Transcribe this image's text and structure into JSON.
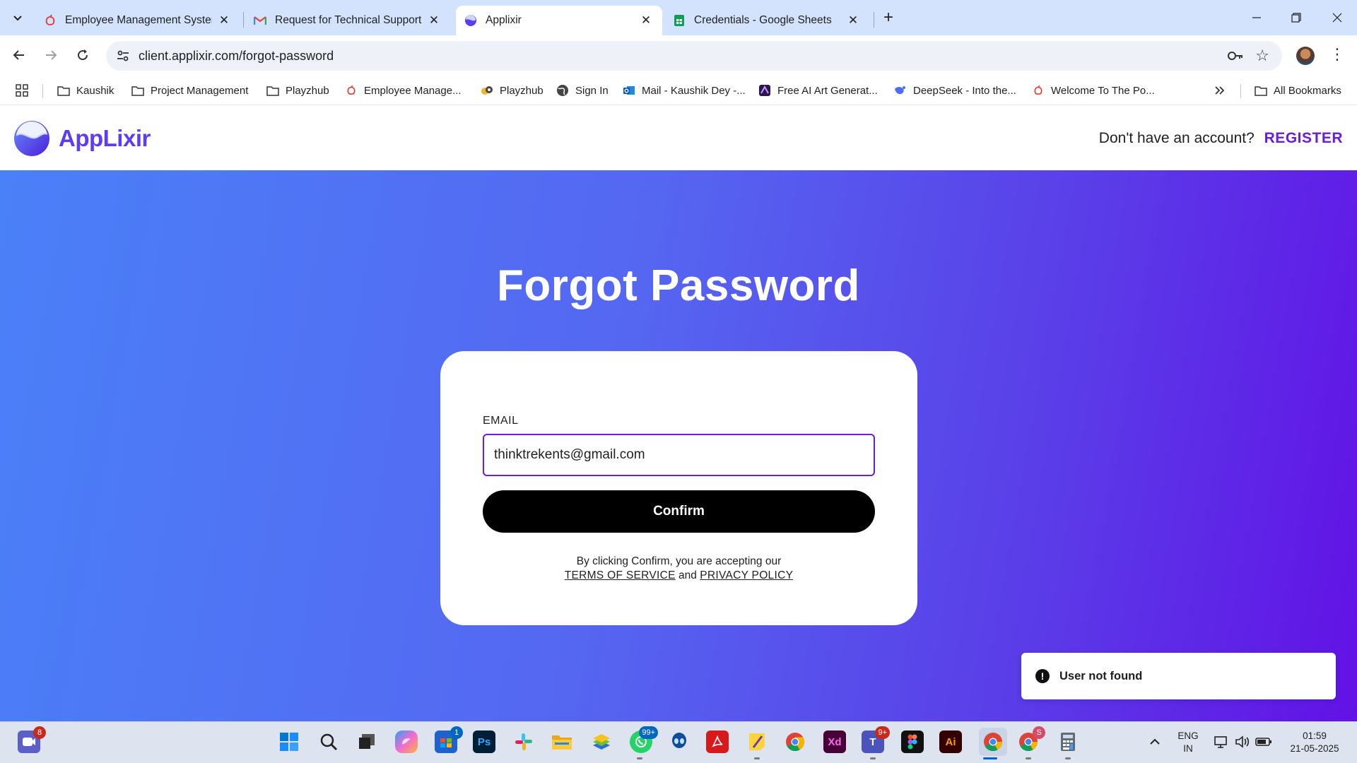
{
  "browser": {
    "tabs": [
      {
        "title": "Employee Management System",
        "icon": "acorn-red-icon"
      },
      {
        "title": "Request for Technical Support a",
        "icon": "gmail-icon"
      },
      {
        "title": "Applixir",
        "icon": "applixir-icon",
        "active": true
      },
      {
        "title": "Credentials - Google Sheets",
        "icon": "sheets-icon"
      }
    ],
    "url": "client.applixir.com/forgot-password",
    "bookmarks": [
      {
        "label": "Kaushik",
        "icon": "folder-icon"
      },
      {
        "label": "Project Management",
        "icon": "folder-icon"
      },
      {
        "label": "Playzhub",
        "icon": "folder-icon"
      },
      {
        "label": "Employee Manage...",
        "icon": "acorn-red-icon"
      },
      {
        "label": "Playzhub",
        "icon": "playzhub-icon"
      },
      {
        "label": "Sign In",
        "icon": "globe-icon"
      },
      {
        "label": "Mail - Kaushik Dey -...",
        "icon": "outlook-icon"
      },
      {
        "label": "Free AI Art Generat...",
        "icon": "ai-art-icon"
      },
      {
        "label": "DeepSeek - Into the...",
        "icon": "deepseek-icon"
      },
      {
        "label": "Welcome To The Po...",
        "icon": "acorn-red-icon"
      }
    ],
    "all_bookmarks": "All Bookmarks"
  },
  "site": {
    "logo_text": "AppLixir",
    "account_prompt": "Don't have an account?",
    "register_label": "REGISTER"
  },
  "form": {
    "title": "Forgot Password",
    "email_label": "EMAIL",
    "email_value": "thinktrekents@gmail.com",
    "confirm_label": "Confirm",
    "legal_prefix": "By clicking Confirm, you are accepting our",
    "terms_label": "TERMS OF SERVICE",
    "and_text": "and",
    "privacy_label": "PRIVACY POLICY"
  },
  "toast": {
    "message": "User not found"
  },
  "taskbar": {
    "badges": {
      "teams_chat": "8",
      "store": "1",
      "whatsapp": "99+",
      "teams": "9+",
      "chrome_profile": "S"
    },
    "language": "ENG",
    "region": "IN",
    "time": "01:59",
    "date": "21-05-2025"
  },
  "colors": {
    "brand": "#5b3df5",
    "register": "#6a1fd6",
    "hero_start": "#4a80f8",
    "hero_end": "#6212e6",
    "button": "#000000"
  }
}
